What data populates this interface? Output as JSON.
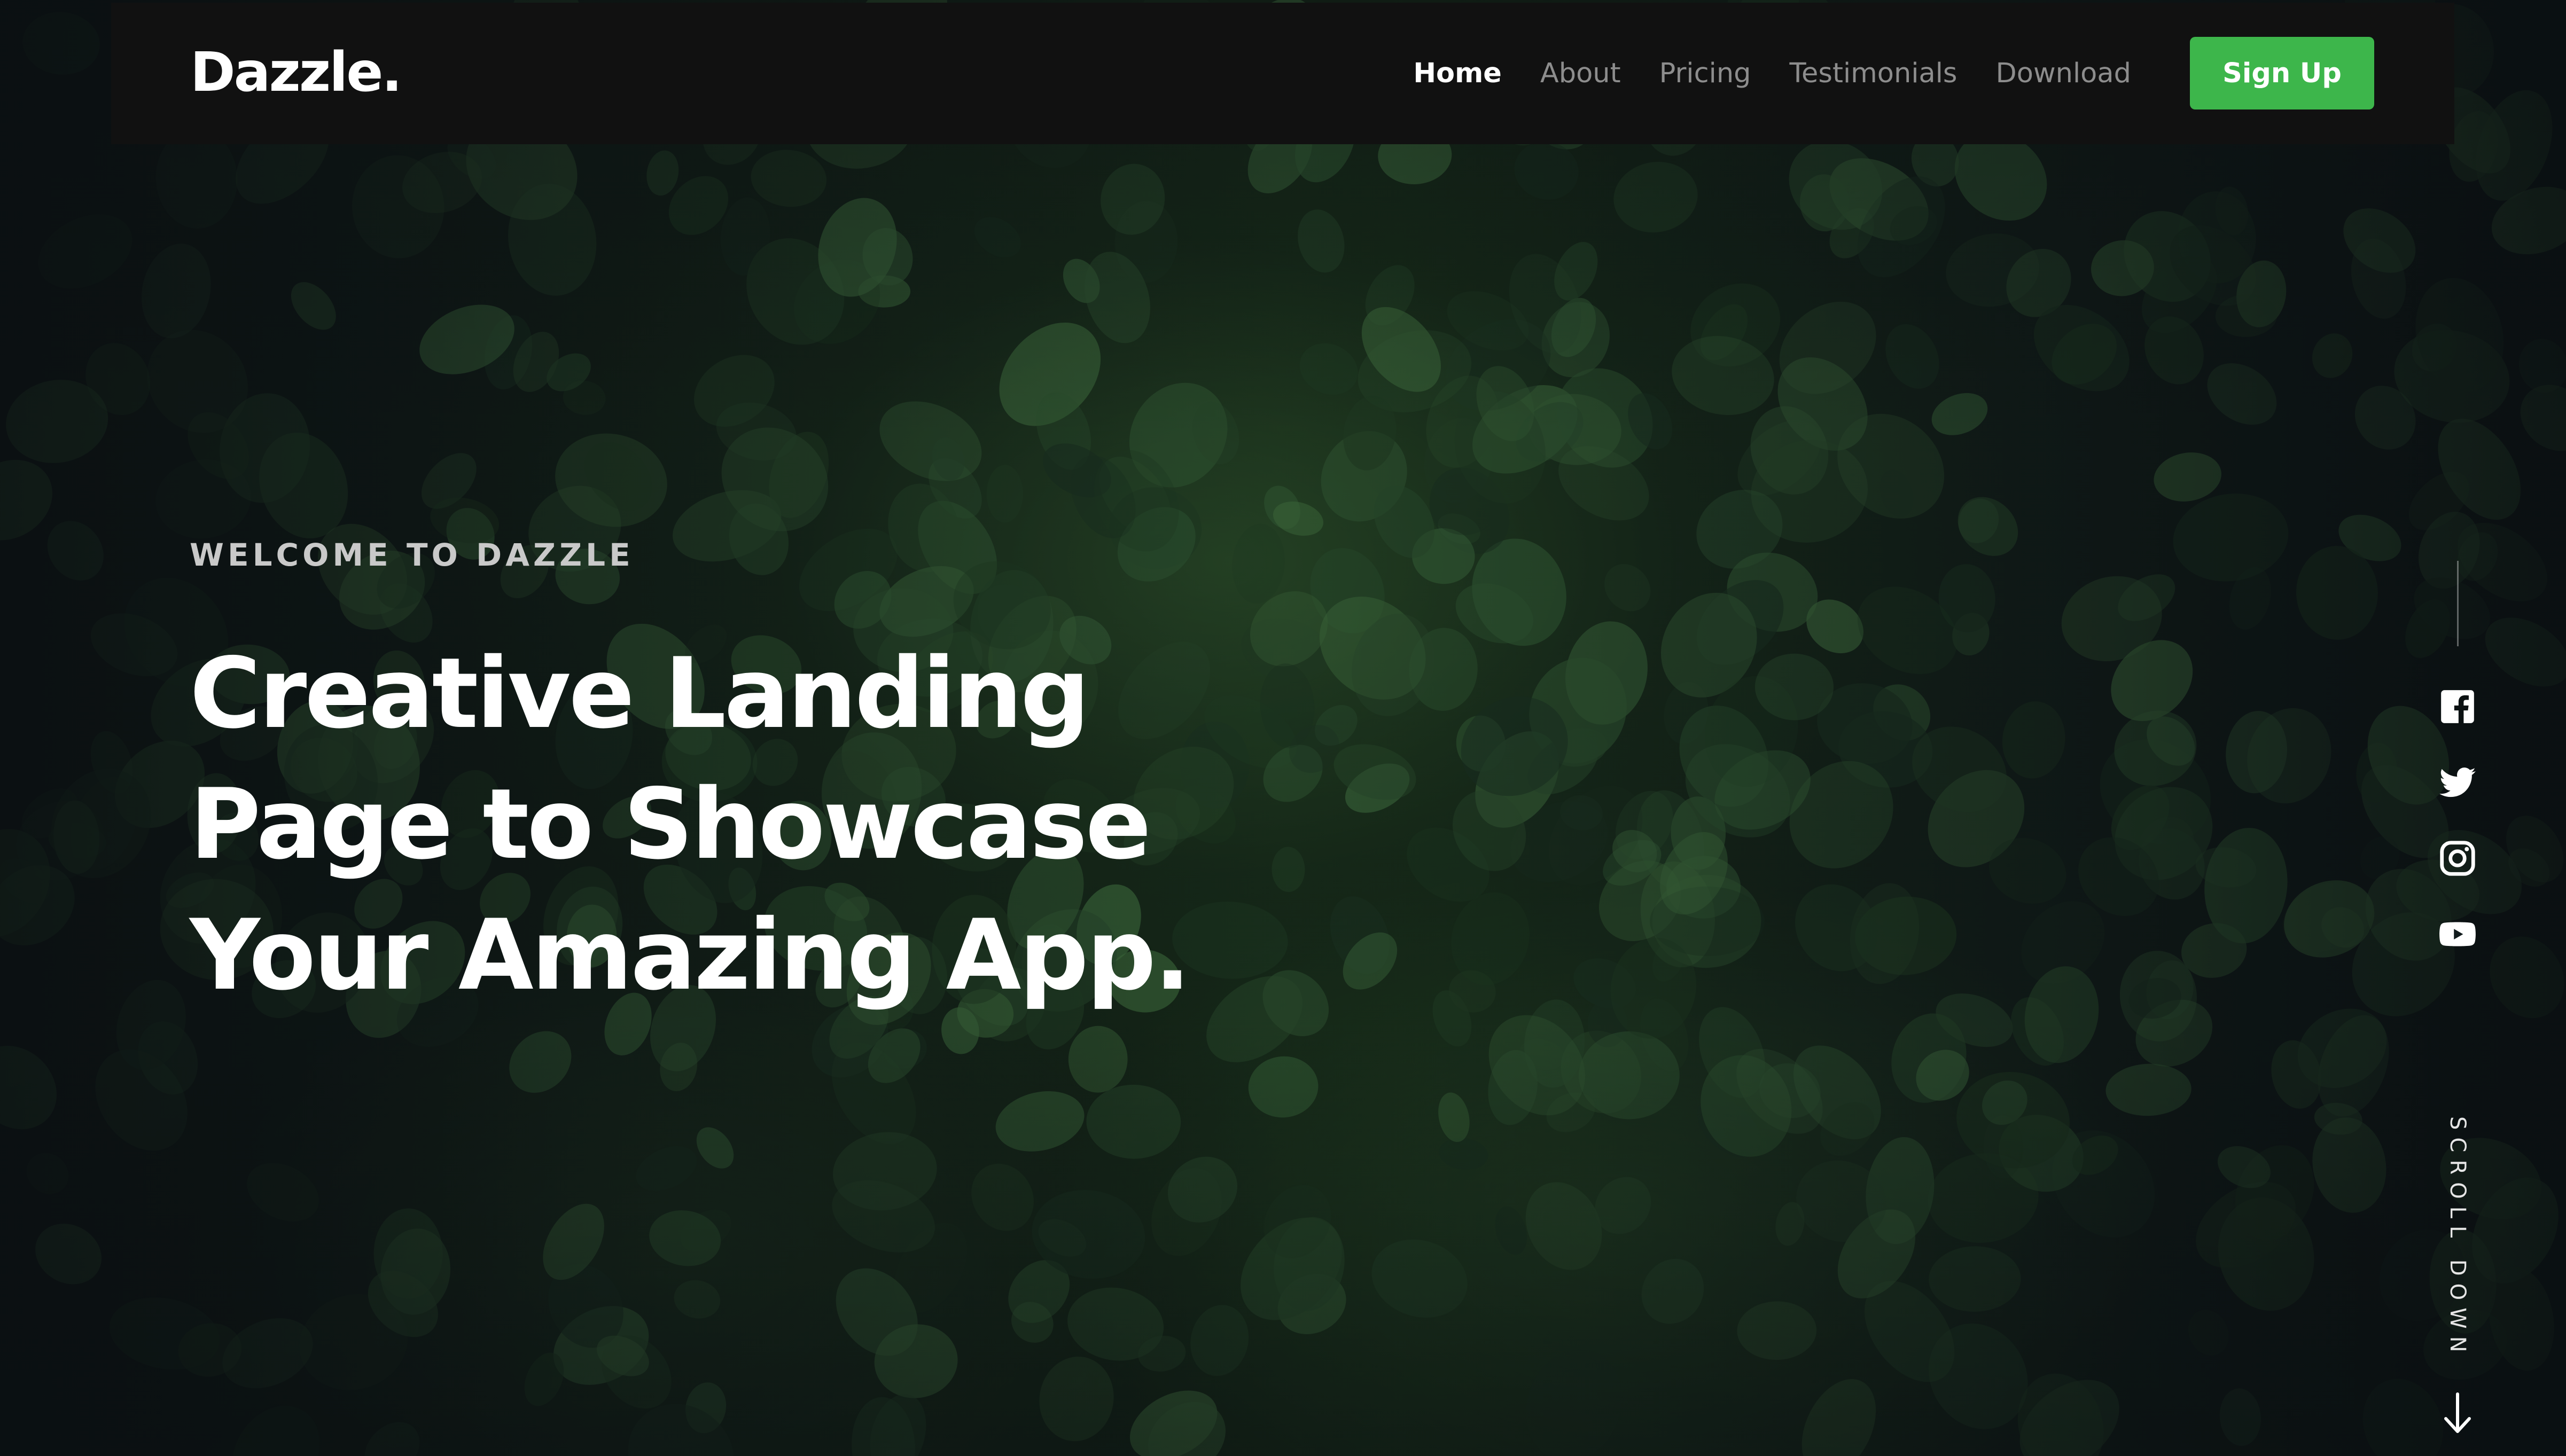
{
  "brand": {
    "name": "Dazzle."
  },
  "nav": {
    "items": [
      {
        "label": "Home",
        "active": true
      },
      {
        "label": "About",
        "active": false
      },
      {
        "label": "Pricing",
        "active": false
      },
      {
        "label": "Testimonials",
        "active": false
      },
      {
        "label": "Download",
        "active": false
      }
    ],
    "cta_label": "Sign Up"
  },
  "hero": {
    "eyebrow": "WELCOME TO DAZZLE",
    "headline_lines": [
      "Creative Landing",
      "Page to Showcase",
      "Your Amazing App."
    ]
  },
  "social": [
    {
      "icon": "facebook-icon"
    },
    {
      "icon": "twitter-icon"
    },
    {
      "icon": "instagram-icon"
    },
    {
      "icon": "youtube-icon"
    }
  ],
  "scroll": {
    "label": "SCROLL DOWN"
  },
  "colors": {
    "accent": "#3db64b",
    "navbar_bg": "#111111",
    "nav_inactive": "#8d8d8d",
    "text": "#ffffff"
  }
}
